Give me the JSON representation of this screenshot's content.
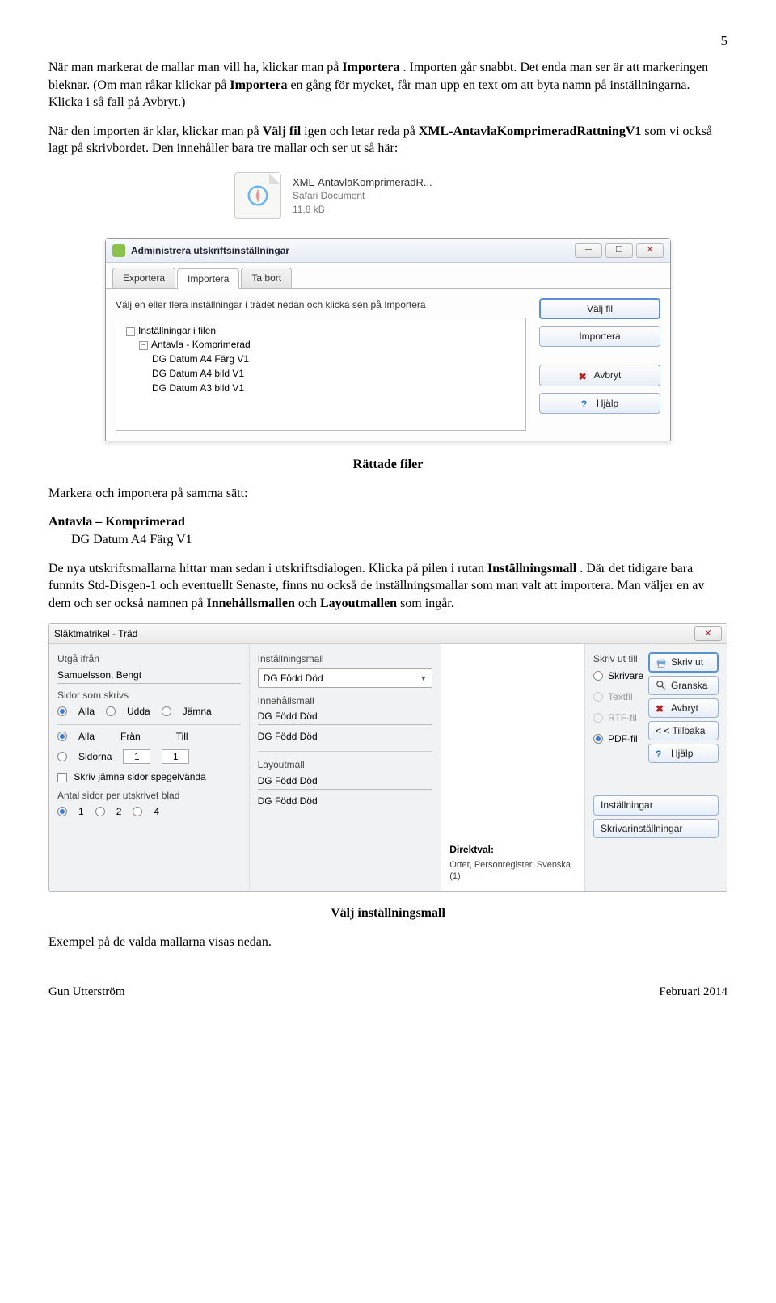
{
  "page_number": "5",
  "para1_a": "När man markerat de mallar man vill ha, klickar man på ",
  "para1_b": "Importera",
  "para1_c": ". Importen går snabbt. Det enda man ser är att markeringen bleknar. (Om man råkar klickar på ",
  "para1_d": "Importera",
  "para1_e": " en gång för mycket, får man upp en text om att byta namn på inställningarna. Klicka i så fall på Avbryt.)",
  "para2_a": "När den importen är klar, klickar man på ",
  "para2_b": "Välj fil",
  "para2_c": " igen och letar reda på ",
  "para2_d": "XML-AntavlaKomprimeradRattningV1",
  "para2_e": " som vi också lagt på skrivbordet. Den innehåller bara tre mallar och ser ut så här:",
  "file": {
    "name": "XML-AntavlaKomprimeradR...",
    "type": "Safari Document",
    "size": "11,8 kB"
  },
  "dlg1": {
    "title": "Administrera utskriftsinställningar",
    "tabs": {
      "export": "Exportera",
      "import": "Importera",
      "remove": "Ta bort"
    },
    "instr": "Välj en eller flera inställningar i trädet nedan och klicka sen på Importera",
    "btn_valj": "Välj fil",
    "btn_import": "Importera",
    "btn_avbryt": "Avbryt",
    "btn_hjalp": "Hjälp",
    "tree": {
      "root": "Inställningar i filen",
      "group": "Antavla - Komprimerad",
      "items": [
        "DG Datum A4 Färg V1",
        "DG Datum A4 bild V1",
        "DG Datum A3 bild V1"
      ]
    }
  },
  "rattade_filer": "Rättade filer",
  "markera_text": "Markera och importera på samma sätt:",
  "antavla_head": "Antavla – Komprimerad",
  "antavla_item": "DG Datum A4 Färg V1",
  "para3_a": "De nya utskriftsmallarna hittar man sedan i utskriftsdialogen. Klicka på pilen i rutan ",
  "para3_b": "Inställningsmall",
  "para3_c": ". Där det tidigare bara funnits Std-Disgen-1 och eventuellt Senaste, finns nu också de inställningsmallar som man valt att importera. Man väljer en av dem och ser också namnen på ",
  "para3_d": "Innehållsmallen",
  "para3_e": " och ",
  "para3_f": "Layoutmallen",
  "para3_g": " som ingår.",
  "dlg2": {
    "title": "Släktmatrikel - Träd",
    "left": {
      "utga": "Utgå ifrån",
      "person": "Samuelsson, Bengt",
      "sidor": "Sidor som skrivs",
      "alla": "Alla",
      "udda": "Udda",
      "jamna": "Jämna",
      "fran": "Från",
      "till": "Till",
      "sidorna": "Sidorna",
      "from_val": "1",
      "to_val": "1",
      "spegel": "Skriv jämna sidor spegelvända",
      "antal": "Antal sidor per utskrivet blad",
      "n1": "1",
      "n2": "2",
      "n4": "4"
    },
    "mid": {
      "inst_lbl": "Inställningsmall",
      "inst_val": "DG Född Död",
      "inne_lbl": "Innehållsmall",
      "inne_val1": "DG Född Död",
      "inne_val2": "DG Född Död",
      "layout_lbl": "Layoutmall",
      "layout_val1": "DG Född Död",
      "layout_val2": "DG Född Död"
    },
    "preview": {
      "direkt_lbl": "Direktval:",
      "direkt_val": "Orter, Personregister, Svenska (1)"
    },
    "right": {
      "skriv_ut_till": "Skriv ut till",
      "skrivare": "Skrivare",
      "textfil": "Textfil",
      "rtf": "RTF-fil",
      "pdf": "PDF-fil",
      "btn_skriv": "Skriv ut",
      "btn_granska": "Granska",
      "btn_avbryt": "Avbryt",
      "btn_tillbaka": "< < Tillbaka",
      "btn_hjalp": "Hjälp",
      "btn_inst": "Inställningar",
      "btn_skriv_inst": "Skrivarinställningar"
    }
  },
  "valj_head": "Välj inställningsmall",
  "exempel": "Exempel på de valda mallarna visas nedan.",
  "footer_left": "Gun Utterström",
  "footer_right": "Februari 2014"
}
